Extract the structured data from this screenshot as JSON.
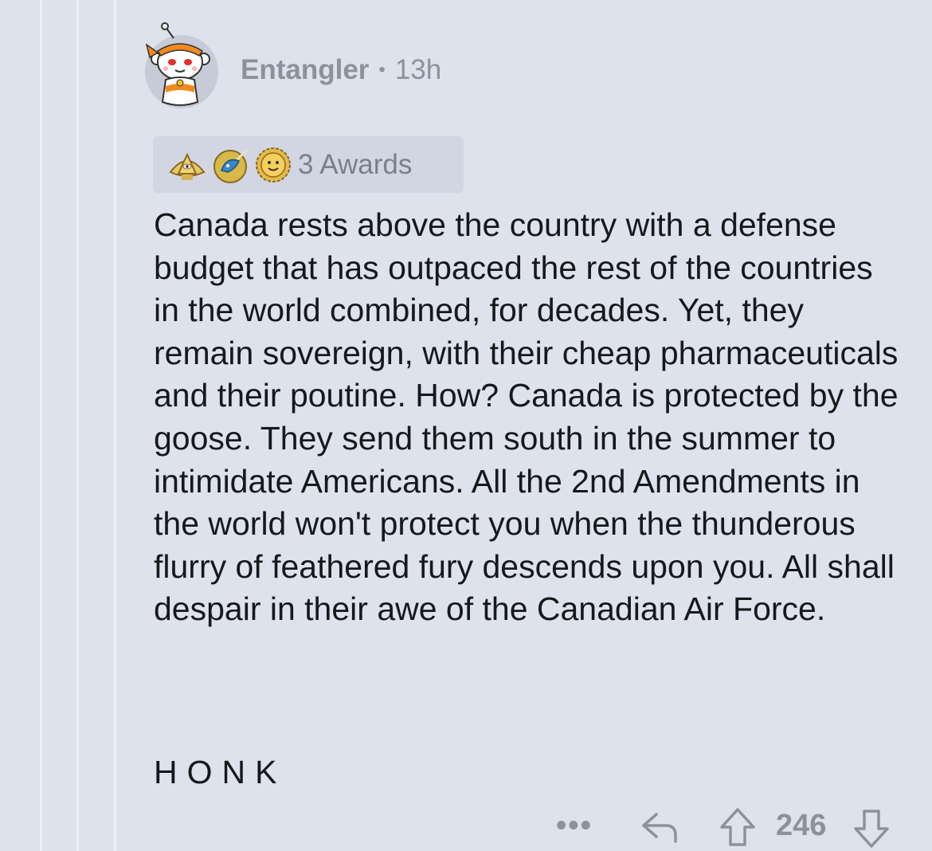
{
  "comment": {
    "author": "Entangler",
    "separator": "•",
    "age": "13h",
    "awards": {
      "icons": [
        "illuminati-award-icon",
        "narwhal-award-icon",
        "wholesome-award-icon"
      ],
      "count_label": "3 Awards"
    },
    "body": "Canada rests above the country with a defense budget that has outpaced the rest of the countries in the world combined, for decades. Yet, they remain sovereign, with their cheap pharmaceuticals and their poutine. How? Canada is protected by the goose. They send them south in the summer to intimidate Americans. All the 2nd Amendments in the world won't protect you when the thunderous flurry of feathered fury descends upon you. All shall despair in their awe of the Canadian Air Force.",
    "signoff": "HONK"
  },
  "actions": {
    "more_label": "•••",
    "score": "246"
  },
  "colors": {
    "background": "#dee2ed",
    "thread_line": "#eef0f6",
    "award_bg": "#d2d6e2",
    "meta_text": "#8d919c",
    "body_text": "#16181c"
  }
}
